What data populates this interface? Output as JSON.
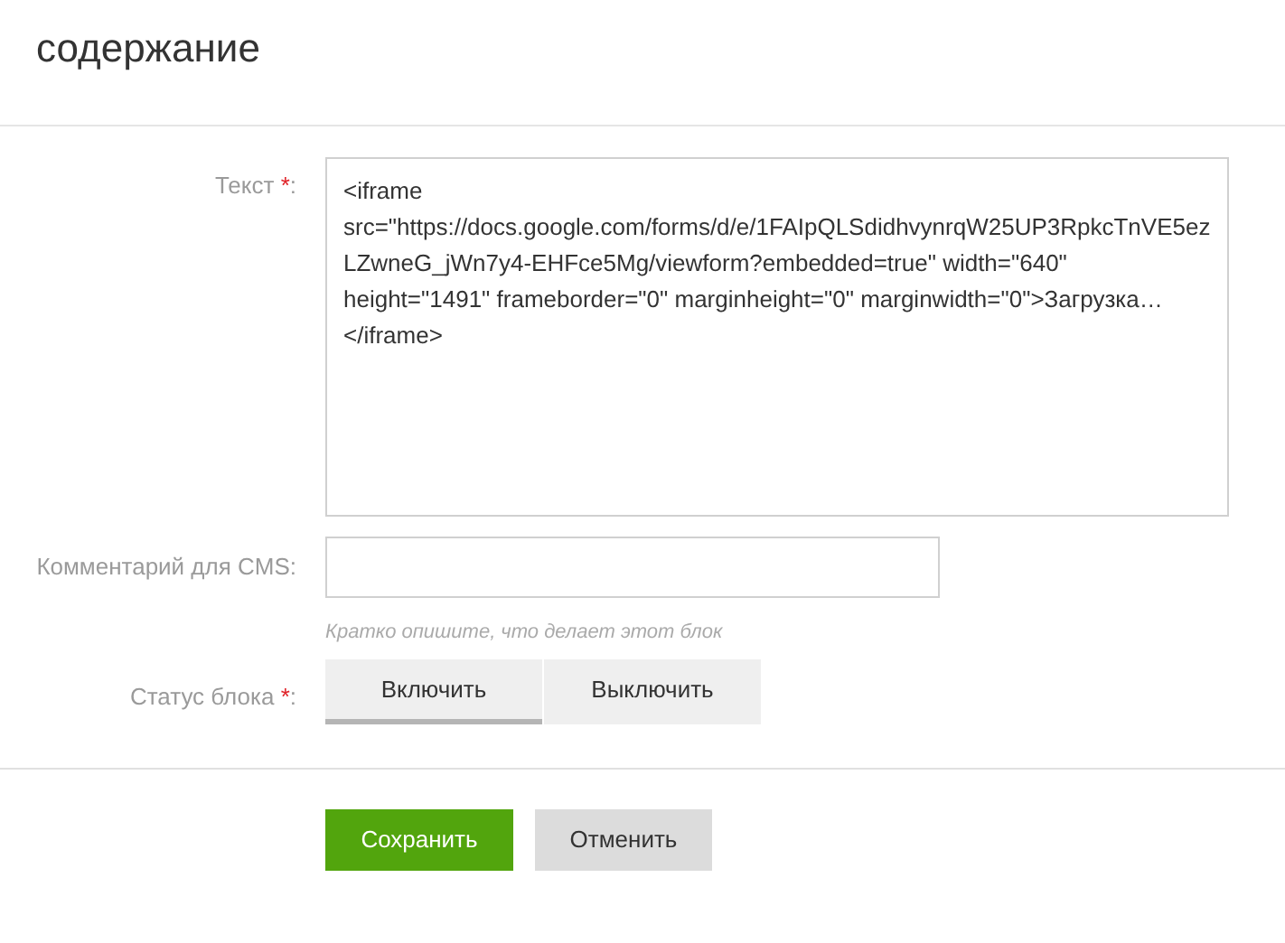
{
  "title": "содержание",
  "text_field": {
    "label": "Текст",
    "required_mark": "*",
    "suffix": ":",
    "value": "<iframe src=\"https://docs.google.com/forms/d/e/1FAIpQLSdidhvynrqW25UP3RpkcTnVE5ezLZwneG_jWn7y4-EHFce5Mg/viewform?embedded=true\" width=\"640\" height=\"1491\" frameborder=\"0\" marginheight=\"0\" marginwidth=\"0\">Загрузка…</iframe>"
  },
  "comment_field": {
    "label": "Комментарий для CMS:",
    "hint": "Кратко опишите, что делает этот блок"
  },
  "status": {
    "label": "Статус блока",
    "required_mark": "*",
    "suffix": ":",
    "options": [
      {
        "label": "Включить",
        "selected": true
      },
      {
        "label": "Выключить",
        "selected": false
      }
    ]
  },
  "buttons": [
    {
      "label": "Сохранить",
      "kind": "primary"
    },
    {
      "label": "Отменить",
      "kind": "secondary"
    }
  ]
}
